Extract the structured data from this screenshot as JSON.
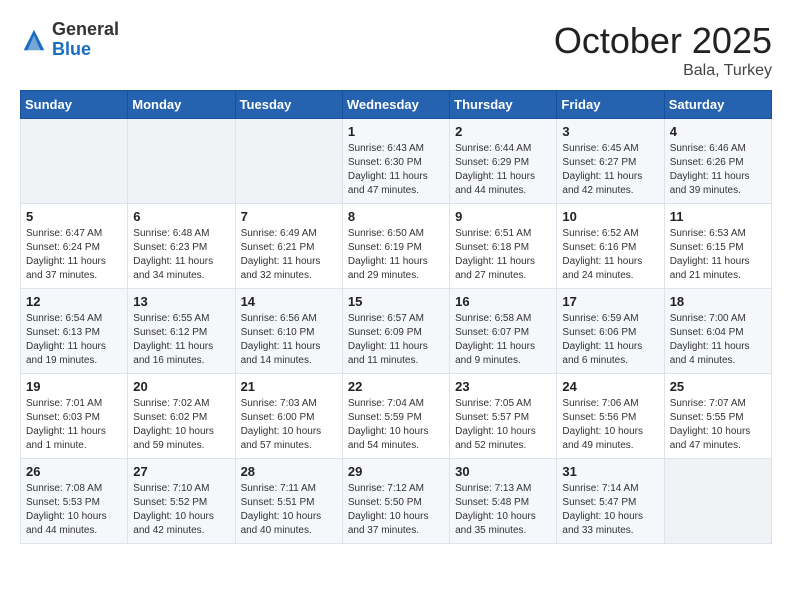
{
  "header": {
    "logo_general": "General",
    "logo_blue": "Blue",
    "month": "October 2025",
    "location": "Bala, Turkey"
  },
  "days_of_week": [
    "Sunday",
    "Monday",
    "Tuesday",
    "Wednesday",
    "Thursday",
    "Friday",
    "Saturday"
  ],
  "weeks": [
    [
      {
        "day": "",
        "text": ""
      },
      {
        "day": "",
        "text": ""
      },
      {
        "day": "",
        "text": ""
      },
      {
        "day": "1",
        "text": "Sunrise: 6:43 AM\nSunset: 6:30 PM\nDaylight: 11 hours and 47 minutes."
      },
      {
        "day": "2",
        "text": "Sunrise: 6:44 AM\nSunset: 6:29 PM\nDaylight: 11 hours and 44 minutes."
      },
      {
        "day": "3",
        "text": "Sunrise: 6:45 AM\nSunset: 6:27 PM\nDaylight: 11 hours and 42 minutes."
      },
      {
        "day": "4",
        "text": "Sunrise: 6:46 AM\nSunset: 6:26 PM\nDaylight: 11 hours and 39 minutes."
      }
    ],
    [
      {
        "day": "5",
        "text": "Sunrise: 6:47 AM\nSunset: 6:24 PM\nDaylight: 11 hours and 37 minutes."
      },
      {
        "day": "6",
        "text": "Sunrise: 6:48 AM\nSunset: 6:23 PM\nDaylight: 11 hours and 34 minutes."
      },
      {
        "day": "7",
        "text": "Sunrise: 6:49 AM\nSunset: 6:21 PM\nDaylight: 11 hours and 32 minutes."
      },
      {
        "day": "8",
        "text": "Sunrise: 6:50 AM\nSunset: 6:19 PM\nDaylight: 11 hours and 29 minutes."
      },
      {
        "day": "9",
        "text": "Sunrise: 6:51 AM\nSunset: 6:18 PM\nDaylight: 11 hours and 27 minutes."
      },
      {
        "day": "10",
        "text": "Sunrise: 6:52 AM\nSunset: 6:16 PM\nDaylight: 11 hours and 24 minutes."
      },
      {
        "day": "11",
        "text": "Sunrise: 6:53 AM\nSunset: 6:15 PM\nDaylight: 11 hours and 21 minutes."
      }
    ],
    [
      {
        "day": "12",
        "text": "Sunrise: 6:54 AM\nSunset: 6:13 PM\nDaylight: 11 hours and 19 minutes."
      },
      {
        "day": "13",
        "text": "Sunrise: 6:55 AM\nSunset: 6:12 PM\nDaylight: 11 hours and 16 minutes."
      },
      {
        "day": "14",
        "text": "Sunrise: 6:56 AM\nSunset: 6:10 PM\nDaylight: 11 hours and 14 minutes."
      },
      {
        "day": "15",
        "text": "Sunrise: 6:57 AM\nSunset: 6:09 PM\nDaylight: 11 hours and 11 minutes."
      },
      {
        "day": "16",
        "text": "Sunrise: 6:58 AM\nSunset: 6:07 PM\nDaylight: 11 hours and 9 minutes."
      },
      {
        "day": "17",
        "text": "Sunrise: 6:59 AM\nSunset: 6:06 PM\nDaylight: 11 hours and 6 minutes."
      },
      {
        "day": "18",
        "text": "Sunrise: 7:00 AM\nSunset: 6:04 PM\nDaylight: 11 hours and 4 minutes."
      }
    ],
    [
      {
        "day": "19",
        "text": "Sunrise: 7:01 AM\nSunset: 6:03 PM\nDaylight: 11 hours and 1 minute."
      },
      {
        "day": "20",
        "text": "Sunrise: 7:02 AM\nSunset: 6:02 PM\nDaylight: 10 hours and 59 minutes."
      },
      {
        "day": "21",
        "text": "Sunrise: 7:03 AM\nSunset: 6:00 PM\nDaylight: 10 hours and 57 minutes."
      },
      {
        "day": "22",
        "text": "Sunrise: 7:04 AM\nSunset: 5:59 PM\nDaylight: 10 hours and 54 minutes."
      },
      {
        "day": "23",
        "text": "Sunrise: 7:05 AM\nSunset: 5:57 PM\nDaylight: 10 hours and 52 minutes."
      },
      {
        "day": "24",
        "text": "Sunrise: 7:06 AM\nSunset: 5:56 PM\nDaylight: 10 hours and 49 minutes."
      },
      {
        "day": "25",
        "text": "Sunrise: 7:07 AM\nSunset: 5:55 PM\nDaylight: 10 hours and 47 minutes."
      }
    ],
    [
      {
        "day": "26",
        "text": "Sunrise: 7:08 AM\nSunset: 5:53 PM\nDaylight: 10 hours and 44 minutes."
      },
      {
        "day": "27",
        "text": "Sunrise: 7:10 AM\nSunset: 5:52 PM\nDaylight: 10 hours and 42 minutes."
      },
      {
        "day": "28",
        "text": "Sunrise: 7:11 AM\nSunset: 5:51 PM\nDaylight: 10 hours and 40 minutes."
      },
      {
        "day": "29",
        "text": "Sunrise: 7:12 AM\nSunset: 5:50 PM\nDaylight: 10 hours and 37 minutes."
      },
      {
        "day": "30",
        "text": "Sunrise: 7:13 AM\nSunset: 5:48 PM\nDaylight: 10 hours and 35 minutes."
      },
      {
        "day": "31",
        "text": "Sunrise: 7:14 AM\nSunset: 5:47 PM\nDaylight: 10 hours and 33 minutes."
      },
      {
        "day": "",
        "text": ""
      }
    ]
  ]
}
